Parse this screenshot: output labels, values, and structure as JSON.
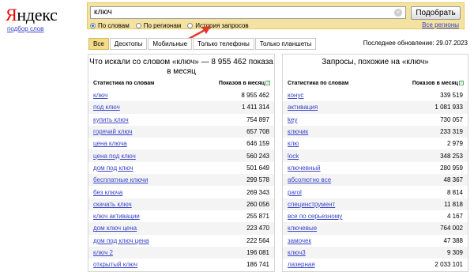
{
  "logo": {
    "first": "Я",
    "rest": "ндекс"
  },
  "sublink": "подбор слов",
  "search": {
    "value": "ключ",
    "submit_label": "Подобрать",
    "clear_glyph": "×",
    "radios": [
      {
        "label": "По словам",
        "checked": true
      },
      {
        "label": "По регионам",
        "checked": false
      },
      {
        "label": "История запросов",
        "checked": false
      }
    ],
    "regions_link": "Все регионы"
  },
  "tabs": [
    {
      "label": "Все",
      "active": true
    },
    {
      "label": "Десктопы",
      "active": false
    },
    {
      "label": "Мобильные",
      "active": false
    },
    {
      "label": "Только телефоны",
      "active": false
    },
    {
      "label": "Только планшеты",
      "active": false
    }
  ],
  "updated": "Последнее обновление: 29.07.2023",
  "left_panel": {
    "title": "Что искали со словом «ключ» — 8 955 462 показа в месяц",
    "col_keywords": "Статистика по словам",
    "col_shows": "Показов в месяц",
    "rows": [
      {
        "keyword": "ключ",
        "shows": "8 955 462"
      },
      {
        "keyword": "под ключ",
        "shows": "1 411 314"
      },
      {
        "keyword": "купить ключ",
        "shows": "754 897"
      },
      {
        "keyword": "горячий ключ",
        "shows": "657 708"
      },
      {
        "keyword": "цена ключа",
        "shows": "646 159"
      },
      {
        "keyword": "цена под ключ",
        "shows": "560 243"
      },
      {
        "keyword": "дом под ключ",
        "shows": "501 649"
      },
      {
        "keyword": "бесплатные ключи",
        "shows": "299 578"
      },
      {
        "keyword": "без ключа",
        "shows": "269 343"
      },
      {
        "keyword": "скачать ключ",
        "shows": "260 056"
      },
      {
        "keyword": "ключ активации",
        "shows": "255 871"
      },
      {
        "keyword": "дом ключ цена",
        "shows": "223 470"
      },
      {
        "keyword": "дом под ключ цена",
        "shows": "222 564"
      },
      {
        "keyword": "ключ 2",
        "shows": "196 081"
      },
      {
        "keyword": "открытый ключ",
        "shows": "186 741"
      }
    ]
  },
  "right_panel": {
    "title": "Запросы, похожие на «ключ»",
    "col_keywords": "Статистика по словам",
    "col_shows": "Показов в месяц",
    "rows": [
      {
        "keyword": "конус",
        "shows": "339 519"
      },
      {
        "keyword": "активация",
        "shows": "1 081 933"
      },
      {
        "keyword": "key",
        "shows": "730 057"
      },
      {
        "keyword": "ключик",
        "shows": "233 319"
      },
      {
        "keyword": "клю",
        "shows": "2 979"
      },
      {
        "keyword": "lock",
        "shows": "348 253"
      },
      {
        "keyword": "ключевный",
        "shows": "280 959"
      },
      {
        "keyword": "абсолютно все",
        "shows": "48 367"
      },
      {
        "keyword": "parol",
        "shows": "8 814"
      },
      {
        "keyword": "специнструмент",
        "shows": "11 818"
      },
      {
        "keyword": "все по серьезному",
        "shows": "4 167"
      },
      {
        "keyword": "ключевые",
        "shows": "764 002"
      },
      {
        "keyword": "замочек",
        "shows": "47 388"
      },
      {
        "keyword": "ключ3",
        "shows": "9 309"
      },
      {
        "keyword": "лазерная",
        "shows": "2 033 101"
      }
    ]
  },
  "help_glyph": "?",
  "colors": {
    "accent_panel": "#f4e3a0",
    "link": "#3a45c7",
    "logo_red": "#ee0000",
    "arrow": "#e23b2e"
  }
}
